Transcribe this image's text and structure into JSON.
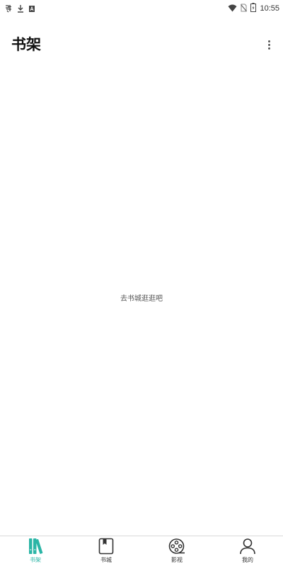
{
  "status_bar": {
    "time": "10:55",
    "left_icons": [
      "app-notification-icon",
      "download-icon",
      "translate-icon"
    ],
    "right_icons": [
      "wifi-icon",
      "no-sim-icon",
      "battery-icon"
    ]
  },
  "header": {
    "title": "书架",
    "menu_icon": "more-vert-icon"
  },
  "main": {
    "empty_message": "去书城逛逛吧"
  },
  "bottom_nav": {
    "active_color": "#2bb5a6",
    "items": [
      {
        "label": "书架",
        "icon": "bookshelf-icon",
        "active": true
      },
      {
        "label": "书城",
        "icon": "book-icon",
        "active": false
      },
      {
        "label": "影视",
        "icon": "film-reel-icon",
        "active": false
      },
      {
        "label": "我的",
        "icon": "person-icon",
        "active": false
      }
    ]
  }
}
